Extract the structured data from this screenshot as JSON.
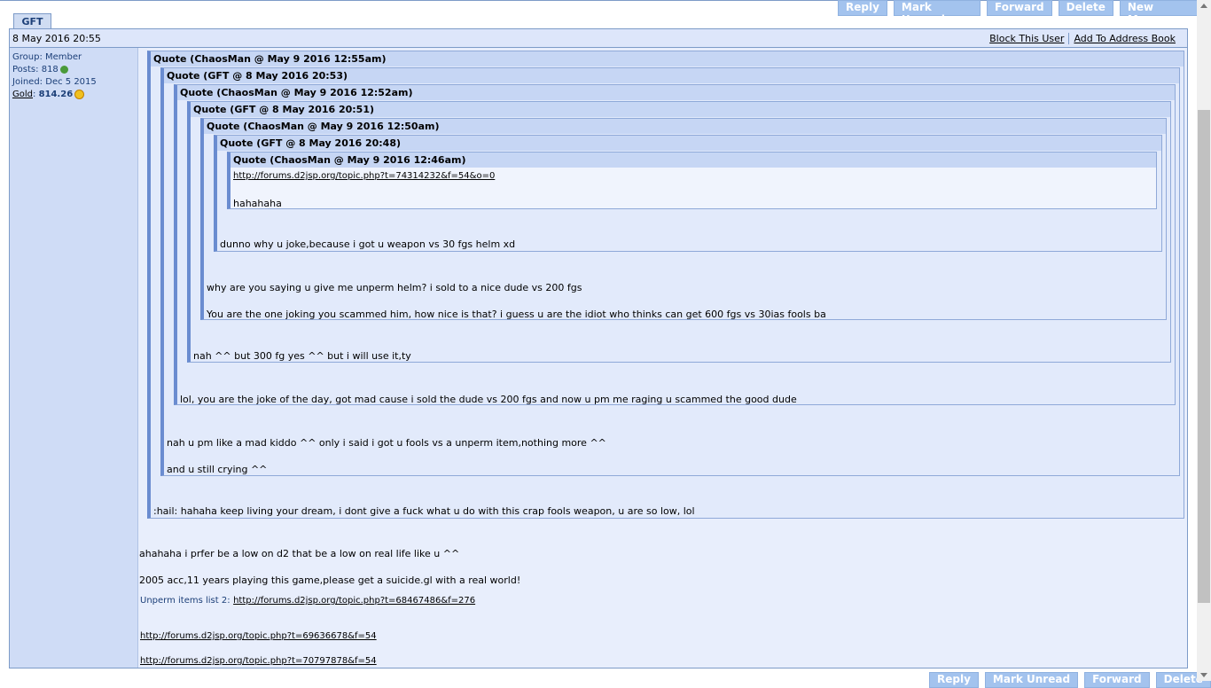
{
  "tab": {
    "label": "GFT"
  },
  "buttons": [
    "Reply",
    "Mark Unread",
    "Forward",
    "Delete",
    "New Message"
  ],
  "bottom_buttons": [
    "Reply",
    "Mark Unread",
    "Forward",
    "Delete"
  ],
  "message": {
    "date": "8 May 2016 20:55",
    "block_link": "Block This User",
    "address_link": "Add To Address Book"
  },
  "user": {
    "group_label": "Group:",
    "group": "Member",
    "posts_label": "Posts:",
    "posts": "818",
    "joined_label": "Joined:",
    "joined": "Dec 5 2015",
    "gold_label": "Gold",
    "gold": "814.26"
  },
  "quotes": [
    {
      "header": "Quote (ChaosMan @ May 9 2016 12:55am)",
      "text1": ":hail: hahaha keep living your dream, i dont give a fuck what u do with this crap fools weapon, u are so low, lol"
    },
    {
      "header": "Quote (GFT @ 8 May 2016 20:53)",
      "text1": "nah u pm like a mad kiddo ^^ only i said i got u fools vs a unperm item,nothing more ^^",
      "text2": "and u still crying ^^"
    },
    {
      "header": "Quote (ChaosMan @ May 9 2016 12:52am)",
      "text1": "lol, you are the joke of the day, got mad cause i sold the dude vs 200 fgs and now u pm me raging u scammed the good dude"
    },
    {
      "header": "Quote (GFT @ 8 May 2016 20:51)",
      "text1": "nah ^^ but 300 fg yes ^^ but i will use it,ty"
    },
    {
      "header": "Quote (ChaosMan @ May 9 2016 12:50am)",
      "text1": "why are you saying u give me unperm helm? i sold to a nice dude vs 200 fgs",
      "text2": "You are the one joking you scammed him, how nice is that? i guess u are the idiot who thinks can get 600 fgs vs 30ias fools ba"
    },
    {
      "header": "Quote (GFT @ 8 May 2016 20:48)",
      "text1": "dunno why u joke,because i got u weapon vs 30 fgs helm xd"
    },
    {
      "header": "Quote (ChaosMan @ May 9 2016 12:46am)",
      "link": "http://forums.d2jsp.org/topic.php?t=74314232&f=54&o=0",
      "text1": "hahahaha"
    }
  ],
  "body": {
    "line1": "ahahaha i prfer be a low on d2 that be a low on real life like u ^^",
    "line2": "2005 acc,11 years playing this game,please get a suicide.gl with a real world!",
    "sig_caption": "Unperm items list 2:",
    "sig_link1": "http://forums.d2jsp.org/topic.php?t=68467486&f=276",
    "sig_link2": "http://forums.d2jsp.org/topic.php?t=69636678&f=54",
    "sig_link3": "http://forums.d2jsp.org/topic.php?t=70797878&f=54"
  }
}
